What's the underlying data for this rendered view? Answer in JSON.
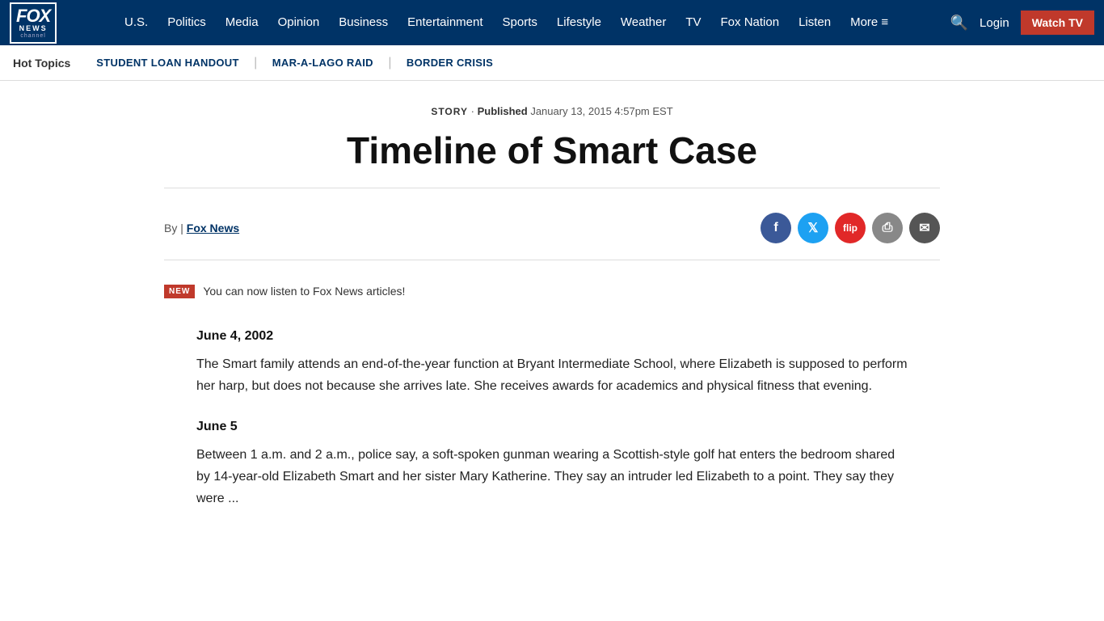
{
  "nav": {
    "items": [
      {
        "label": "U.S.",
        "id": "us"
      },
      {
        "label": "Politics",
        "id": "politics"
      },
      {
        "label": "Media",
        "id": "media"
      },
      {
        "label": "Opinion",
        "id": "opinion"
      },
      {
        "label": "Business",
        "id": "business"
      },
      {
        "label": "Entertainment",
        "id": "entertainment"
      },
      {
        "label": "Sports",
        "id": "sports"
      },
      {
        "label": "Lifestyle",
        "id": "lifestyle"
      },
      {
        "label": "Weather",
        "id": "weather"
      },
      {
        "label": "TV",
        "id": "tv"
      },
      {
        "label": "Fox Nation",
        "id": "fox-nation"
      },
      {
        "label": "Listen",
        "id": "listen"
      },
      {
        "label": "More ≡",
        "id": "more"
      }
    ],
    "login_label": "Login",
    "watch_tv_label": "Watch TV"
  },
  "hot_topics": {
    "label": "Hot Topics",
    "items": [
      {
        "label": "STUDENT LOAN HANDOUT",
        "id": "student-loan"
      },
      {
        "label": "MAR-A-LAGO RAID",
        "id": "mar-a-lago"
      },
      {
        "label": "BORDER CRISIS",
        "id": "border-crisis"
      }
    ]
  },
  "article": {
    "story_label": "STORY",
    "published_label": "Published",
    "published_date": "January 13, 2015 4:57pm EST",
    "title": "Timeline of Smart Case",
    "byline_prefix": "By |",
    "author": "Fox News",
    "new_badge": "NEW",
    "new_badge_text": "You can now listen to Fox News articles!",
    "sections": [
      {
        "date": "June 4, 2002",
        "text": "The Smart family attends an end-of-the-year function at Bryant Intermediate School, where Elizabeth is supposed to perform her harp, but does not because she arrives late. She receives awards for academics and physical fitness that evening."
      },
      {
        "date": "June 5",
        "text": "Between 1 a.m. and 2 a.m., police say, a soft-spoken gunman wearing a Scottish-style golf hat enters the bedroom shared by 14-year-old Elizabeth Smart and her sister Mary Katherine. They say an intruder led Elizabeth to a point. They say they were ..."
      }
    ],
    "share_buttons": [
      {
        "type": "facebook",
        "icon": "f",
        "label": "Facebook"
      },
      {
        "type": "twitter",
        "icon": "t",
        "label": "Twitter"
      },
      {
        "type": "flipboard",
        "icon": "f",
        "label": "Flipboard"
      },
      {
        "type": "print",
        "icon": "⎙",
        "label": "Print"
      },
      {
        "type": "email",
        "icon": "✉",
        "label": "Email"
      }
    ]
  }
}
